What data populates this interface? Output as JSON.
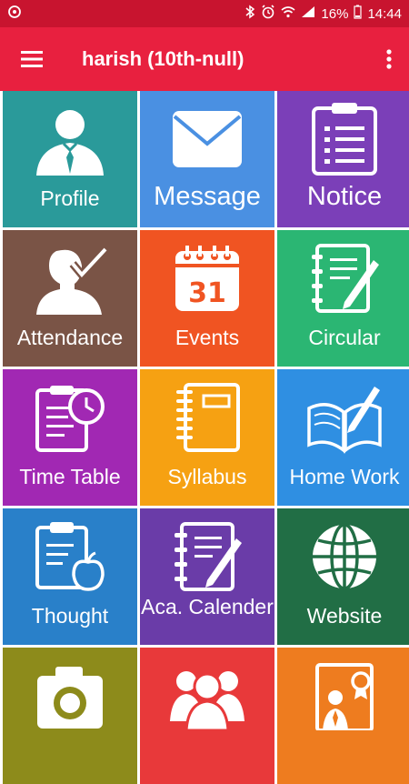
{
  "status": {
    "battery": "16%",
    "time": "14:44"
  },
  "appbar": {
    "title": "harish (10th-null)"
  },
  "tiles": [
    {
      "label": "Profile",
      "color": "#2a9a9a",
      "icon": "teacher-icon"
    },
    {
      "label": "Message",
      "color": "#4a90e2",
      "icon": "envelope-icon"
    },
    {
      "label": "Notice",
      "color": "#7b3fb8",
      "icon": "clipboard-icon"
    },
    {
      "label": "Attendance",
      "color": "#7a5446",
      "icon": "attendance-check-icon"
    },
    {
      "label": "Events",
      "color": "#f05422",
      "icon": "calendar-icon"
    },
    {
      "label": "Circular",
      "color": "#2bb673",
      "icon": "notebook-pen-icon"
    },
    {
      "label": "Time Table",
      "color": "#a128b3",
      "icon": "clipboard-clock-icon"
    },
    {
      "label": "Syllabus",
      "color": "#f6a112",
      "icon": "spiral-notebook-icon"
    },
    {
      "label": "Home Work",
      "color": "#2f8fe2",
      "icon": "open-book-icon"
    },
    {
      "label": "Thought",
      "color": "#2980c9",
      "icon": "clipboard-apple-icon"
    },
    {
      "label": "Aca. Calender",
      "color": "#6a3ca8",
      "icon": "journal-pen-icon"
    },
    {
      "label": "Website",
      "color": "#216e45",
      "icon": "globe-icon"
    },
    {
      "label": "",
      "color": "#8d8b1b",
      "icon": "camera-icon"
    },
    {
      "label": "",
      "color": "#e8393a",
      "icon": "people-group-icon"
    },
    {
      "label": "",
      "color": "#ee7c1f",
      "icon": "certificate-icon"
    }
  ]
}
